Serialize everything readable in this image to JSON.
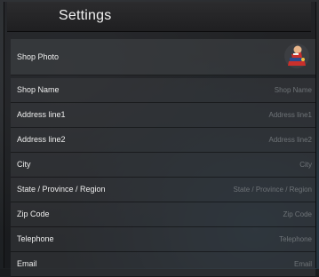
{
  "header": {
    "title": "Settings"
  },
  "shop_photo": {
    "label": "Shop Photo",
    "icon": "shop-avatar-icon"
  },
  "fields": [
    {
      "label": "Shop Name",
      "value": "",
      "placeholder": "Shop Name"
    },
    {
      "label": "Address line1",
      "value": "",
      "placeholder": "Address line1"
    },
    {
      "label": "Address line2",
      "value": "",
      "placeholder": "Address line2"
    },
    {
      "label": "City",
      "value": "",
      "placeholder": "City"
    },
    {
      "label": "State / Province / Region",
      "value": "",
      "placeholder": "State / Province / Region"
    },
    {
      "label": "Zip Code",
      "value": "",
      "placeholder": "Zip Code"
    },
    {
      "label": "Telephone",
      "value": "",
      "placeholder": "Telephone"
    },
    {
      "label": "Email",
      "value": "",
      "placeholder": "Email"
    }
  ],
  "colors": {
    "background": "#1a1c1e",
    "header": "#262628",
    "row": "#3a3c40",
    "placeholder": "#6f7478",
    "label": "#eeeeee"
  }
}
